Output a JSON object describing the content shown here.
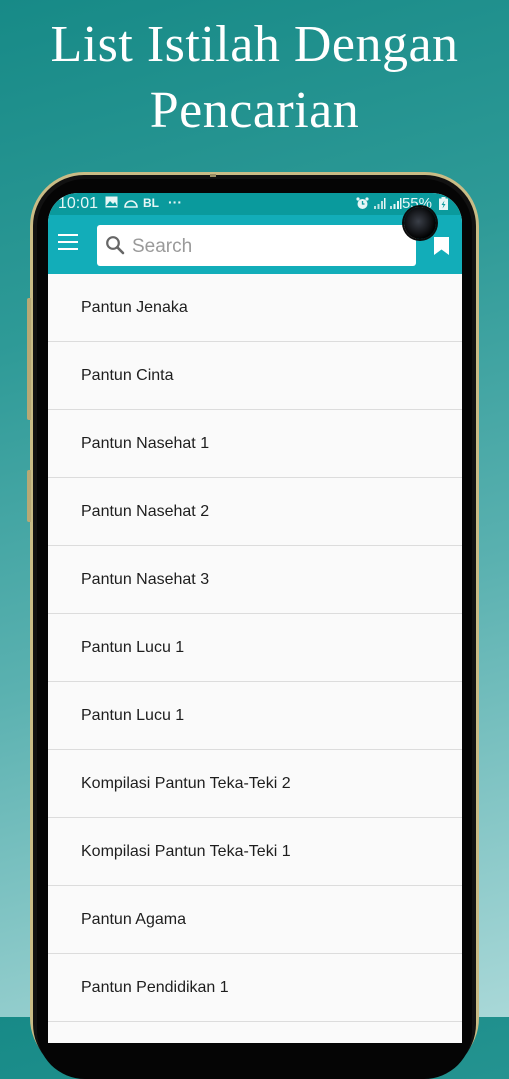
{
  "promo": {
    "title_line1": "List Istilah Dengan",
    "title_line2": "Pencarian"
  },
  "status_bar": {
    "time": "10:01",
    "left_icons": [
      "gallery-icon",
      "cloud-icon"
    ],
    "carrier_label": "BL",
    "more_label": "···",
    "right_icons": [
      "alarm-icon",
      "signal-icon",
      "signal-icon"
    ],
    "battery": "55%"
  },
  "toolbar": {
    "menu_icon": "hamburger-menu-icon",
    "search": {
      "placeholder": "Search",
      "value": ""
    },
    "bookmark_icon": "bookmark-icon"
  },
  "list": {
    "items": [
      {
        "label": "Pantun Jenaka"
      },
      {
        "label": "Pantun Cinta"
      },
      {
        "label": "Pantun Nasehat 1"
      },
      {
        "label": "Pantun Nasehat 2"
      },
      {
        "label": "Pantun Nasehat 3"
      },
      {
        "label": "Pantun Lucu 1"
      },
      {
        "label": "Pantun Lucu 1"
      },
      {
        "label": "Kompilasi Pantun Teka-Teki 2"
      },
      {
        "label": "Kompilasi Pantun Teka-Teki 1"
      },
      {
        "label": "Pantun Agama"
      },
      {
        "label": "Pantun Pendidikan 1"
      }
    ]
  },
  "colors": {
    "toolbar": "#12adb9",
    "status_bar": "#0a9a9d",
    "background_top": "#178a87",
    "background_bottom": "#a9d8d8"
  }
}
